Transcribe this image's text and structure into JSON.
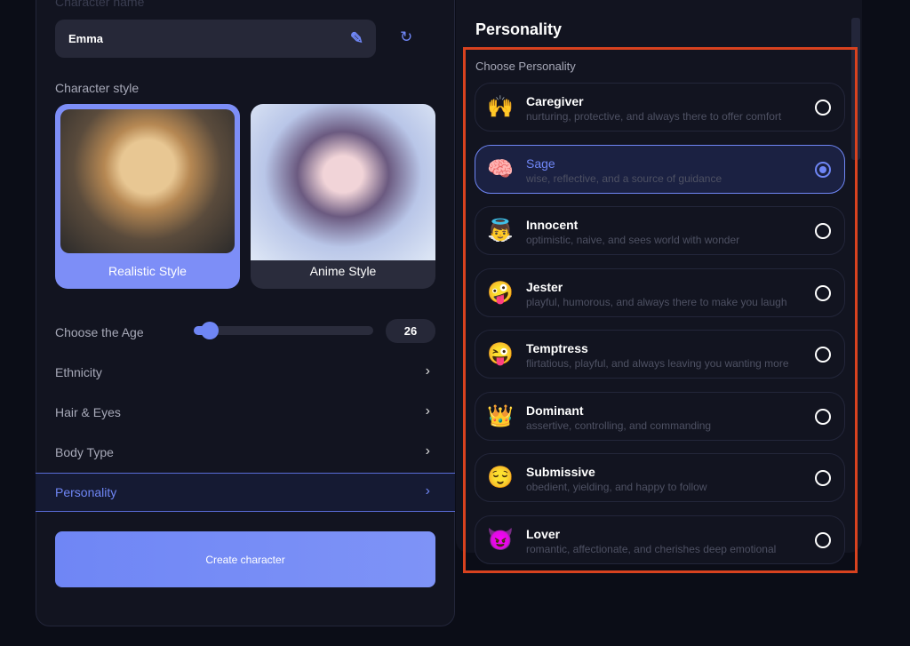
{
  "left": {
    "name_label": "Character name",
    "name_value": "Emma",
    "style_label": "Character style",
    "styles": [
      {
        "label": "Realistic Style",
        "selected": true
      },
      {
        "label": "Anime Style",
        "selected": false
      }
    ],
    "age_label": "Choose the Age",
    "age_value": "26",
    "age_fraction": 0.09,
    "rows": [
      {
        "label": "Ethnicity"
      },
      {
        "label": "Hair & Eyes"
      },
      {
        "label": "Body Type"
      },
      {
        "label": "Personality",
        "active": true
      }
    ],
    "create_label": "Create character"
  },
  "right": {
    "title": "Personality",
    "subtitle": "Choose Personality",
    "items": [
      {
        "emoji": "🙌",
        "title": "Caregiver",
        "desc": "nurturing, protective, and always there to offer comfort",
        "selected": false
      },
      {
        "emoji": "🧠",
        "title": "Sage",
        "desc": "wise, reflective, and a source of guidance",
        "selected": true
      },
      {
        "emoji": "👼",
        "title": "Innocent",
        "desc": "optimistic, naive, and sees world with wonder",
        "selected": false
      },
      {
        "emoji": "🤪",
        "title": "Jester",
        "desc": "playful, humorous, and always there to make you laugh",
        "selected": false
      },
      {
        "emoji": "😜",
        "title": "Temptress",
        "desc": "flirtatious, playful, and always leaving you wanting more",
        "selected": false
      },
      {
        "emoji": "👑",
        "title": "Dominant",
        "desc": "assertive, controlling, and commanding",
        "selected": false
      },
      {
        "emoji": "😌",
        "title": "Submissive",
        "desc": "obedient, yielding, and happy to follow",
        "selected": false
      },
      {
        "emoji": "😈",
        "title": "Lover",
        "desc": "romantic, affectionate, and cherishes deep emotional",
        "selected": false
      }
    ]
  },
  "colors": {
    "accent": "#6f86f5",
    "highlight": "#d8421f",
    "background": "#0b0d17"
  }
}
